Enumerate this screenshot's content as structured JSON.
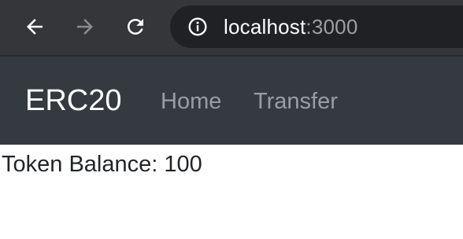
{
  "browser": {
    "url_host": "localhost",
    "url_port": ":3000",
    "icons": {
      "back": "back-arrow-icon",
      "forward": "forward-arrow-icon",
      "reload": "reload-icon",
      "info": "info-icon"
    }
  },
  "navbar": {
    "brand": "ERC20",
    "links": [
      {
        "label": "Home"
      },
      {
        "label": "Transfer"
      }
    ]
  },
  "main": {
    "balance_label": "Token Balance: ",
    "balance_value": "100"
  },
  "colors": {
    "toolbar_bg": "#35363a",
    "omnibox_bg": "#202124",
    "navbar_bg": "#343a40",
    "text_dark": "#212529"
  }
}
